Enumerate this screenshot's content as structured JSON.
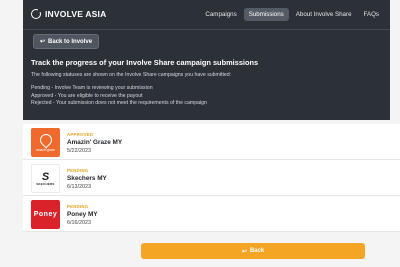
{
  "app": {
    "brand": "INVOLVE ASIA"
  },
  "nav": {
    "links": [
      {
        "label": "Campaigns",
        "active": false
      },
      {
        "label": "Submissions",
        "active": true
      },
      {
        "label": "About Involve Share",
        "active": false
      },
      {
        "label": "FAQs",
        "active": false
      }
    ]
  },
  "header": {
    "back_label": "Back to Involve",
    "title": "Track the progress of your Involve Share campaign submissions",
    "intro": "The following statuses are shown on the Involve Share campaigns you have submitted:",
    "statuses": [
      "Pending - Involve Team is reviewing your submission",
      "Approved - You are eligible to receive the payout",
      "Rejected - Your submission does not meet the requirements of the campaign"
    ]
  },
  "submissions": [
    {
      "status": "APPROVED",
      "brand": "Amazin' Graze MY",
      "date": "5/22/2023",
      "logo_caption": "amazin'graze"
    },
    {
      "status": "PENDING",
      "brand": "Skechers MY",
      "date": "6/13/2023",
      "logo_caption": "SKECHERS",
      "logo_mark": "S"
    },
    {
      "status": "PENDING",
      "brand": "Poney MY",
      "date": "6/16/2023",
      "logo_caption": "Poney"
    }
  ],
  "footer": {
    "back_label": "Back"
  },
  "colors": {
    "topbar": "#2c3037",
    "status": "#e9a21f",
    "button": "#f5a524"
  }
}
